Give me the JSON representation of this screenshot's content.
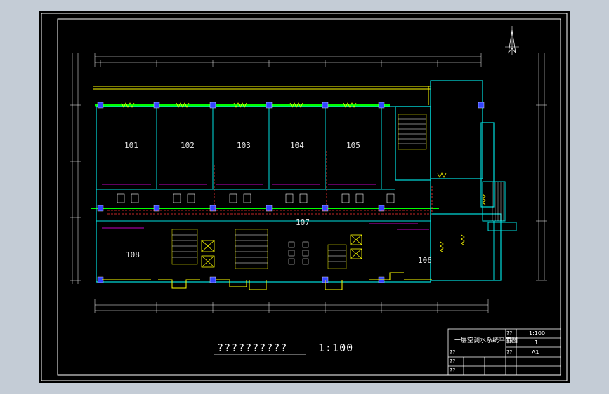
{
  "drawing": {
    "rooms": [
      {
        "id": "r101",
        "num": "101"
      },
      {
        "id": "r102",
        "num": "102"
      },
      {
        "id": "r103",
        "num": "103"
      },
      {
        "id": "r104",
        "num": "104"
      },
      {
        "id": "r105",
        "num": "105"
      },
      {
        "id": "r107",
        "num": "107"
      },
      {
        "id": "r108",
        "num": "108"
      },
      {
        "id": "r106",
        "num": "106"
      }
    ],
    "caption": {
      "title": "??????????",
      "scale": "1:100"
    },
    "title_block": {
      "drawing_name": "一层空调水系统平面图",
      "scale_label": "??",
      "scale_value": "1:100",
      "sheet_label": "??",
      "sheet_value": "1",
      "size_label": "??",
      "size_value": "A1",
      "row_labels": [
        "??",
        "??",
        "??"
      ]
    }
  },
  "colors": {
    "background": "#000000",
    "frame": "#ffffff",
    "wall": "#00e0e0",
    "partition": "#ff00ff",
    "pipe": "#00ff00",
    "supply": "#ff3333",
    "accent": "#ffff00",
    "column": "#3344ff"
  }
}
